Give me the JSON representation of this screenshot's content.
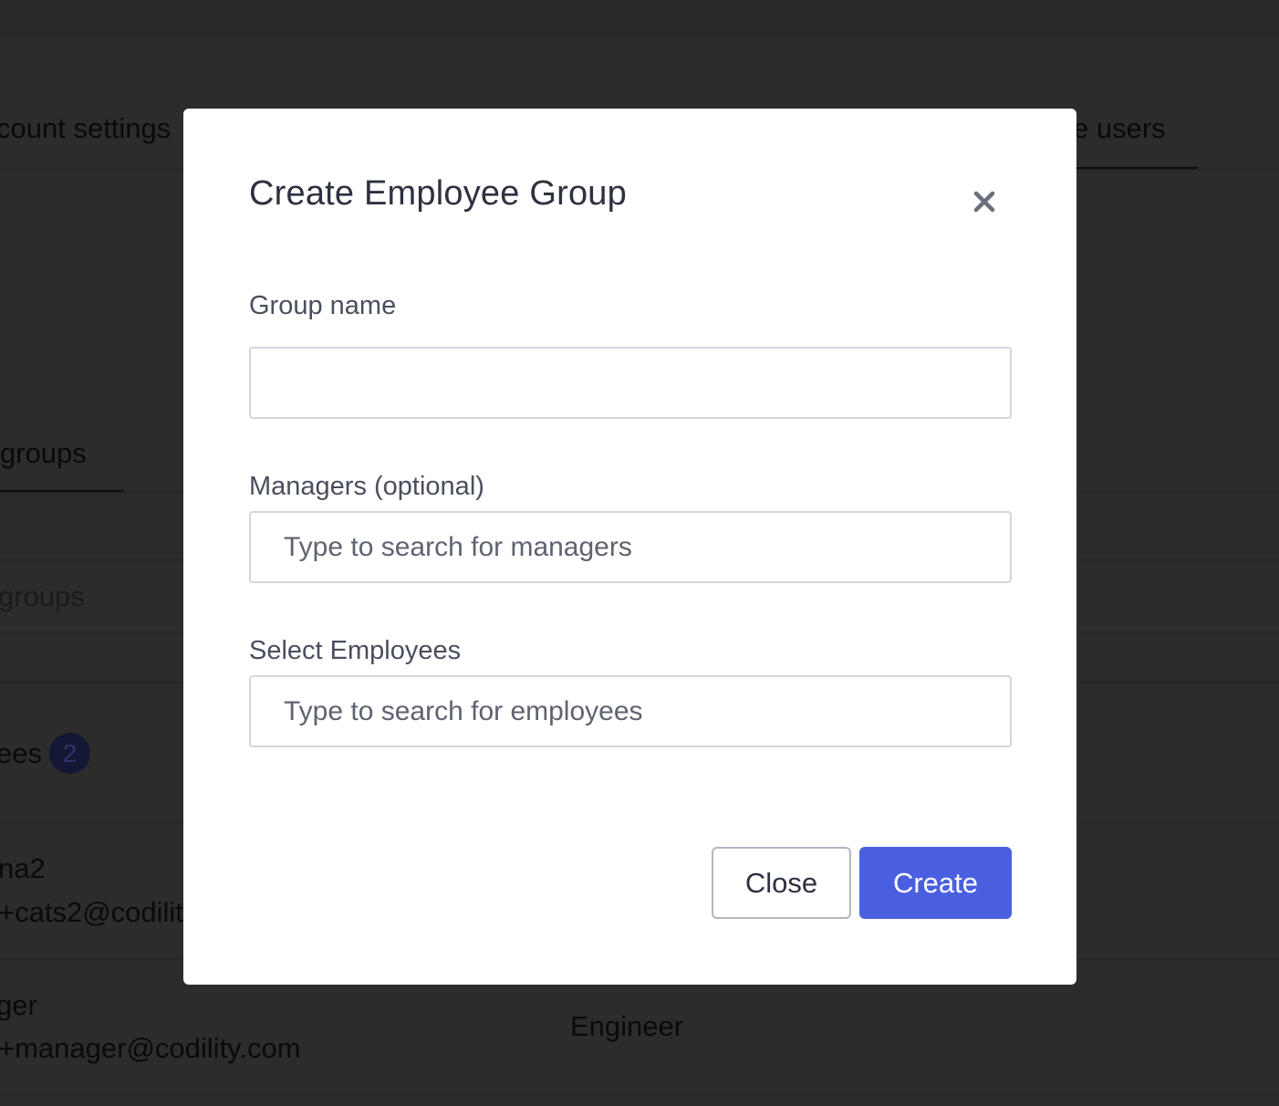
{
  "background": {
    "tabs": {
      "account_settings": "count settings",
      "manage_users": "e users"
    },
    "subtabs": {
      "groups": " groups"
    },
    "list_header": "groups",
    "employees_section": {
      "label": "ees",
      "count": "2"
    },
    "rows": [
      {
        "name": "na2",
        "email": "+cats2@codilit",
        "role": ""
      },
      {
        "name": "ger",
        "email": "+manager@codility.com",
        "role": "Engineer"
      }
    ]
  },
  "modal": {
    "title": "Create Employee Group",
    "close_icon": "close-icon",
    "fields": {
      "group_name": {
        "label": "Group name",
        "value": "",
        "placeholder": ""
      },
      "managers": {
        "label": "Managers (optional)",
        "value": "",
        "placeholder": "Type to search for managers"
      },
      "employees": {
        "label": "Select Employees",
        "value": "",
        "placeholder": "Type to search for employees"
      }
    },
    "buttons": {
      "close": "Close",
      "create": "Create"
    }
  },
  "colors": {
    "primary": "#4a5fe0",
    "overlay": "#2c2c2c",
    "title_text": "#2e3140"
  }
}
